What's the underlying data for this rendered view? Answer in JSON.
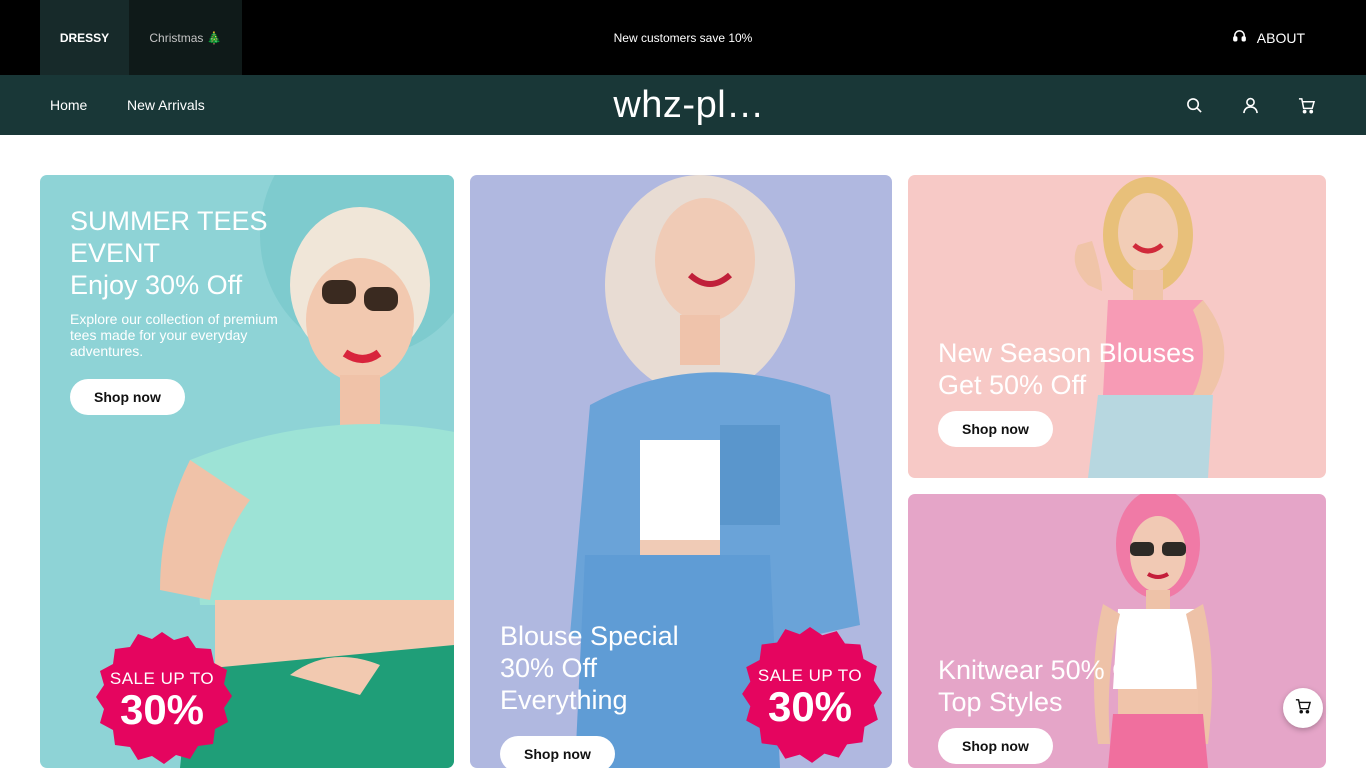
{
  "topbar": {
    "stores": [
      {
        "label": "DRESSY"
      },
      {
        "label": "Christmas 🎄"
      }
    ],
    "announcement": "New customers save 10%",
    "about_label": "ABOUT"
  },
  "nav": {
    "links": [
      {
        "label": "Home"
      },
      {
        "label": "New Arrivals"
      }
    ],
    "logo": "whz-pl…",
    "icons": [
      "search-icon",
      "account-icon",
      "cart-icon"
    ]
  },
  "banners": [
    {
      "title_lines": [
        "SUMMER TEES",
        "EVENT",
        "Enjoy 30% Off"
      ],
      "description": "Explore our collection of premium tees made for your everyday adventures.",
      "button": "Shop now",
      "badge": {
        "small": "SALE UP TO",
        "big": "30%"
      },
      "color": "#8ed3d6"
    },
    {
      "title_lines": [
        "Blouse Special",
        "30% Off",
        "Everything"
      ],
      "button": "Shop now",
      "badge": {
        "small": "SALE UP TO",
        "big": "30%"
      },
      "color": "#b0b8e0"
    },
    {
      "title_lines": [
        "New Season Blouses",
        "Get 50% Off"
      ],
      "button": "Shop now",
      "color": "#f7c9c6"
    },
    {
      "title_lines": [
        "Knitwear 50% Off",
        "Top Styles"
      ],
      "button": "Shop now",
      "color": "#e5a5c8"
    }
  ],
  "colors": {
    "topbar": "#000000",
    "navbar": "#193737",
    "badge": "#e5055f"
  }
}
